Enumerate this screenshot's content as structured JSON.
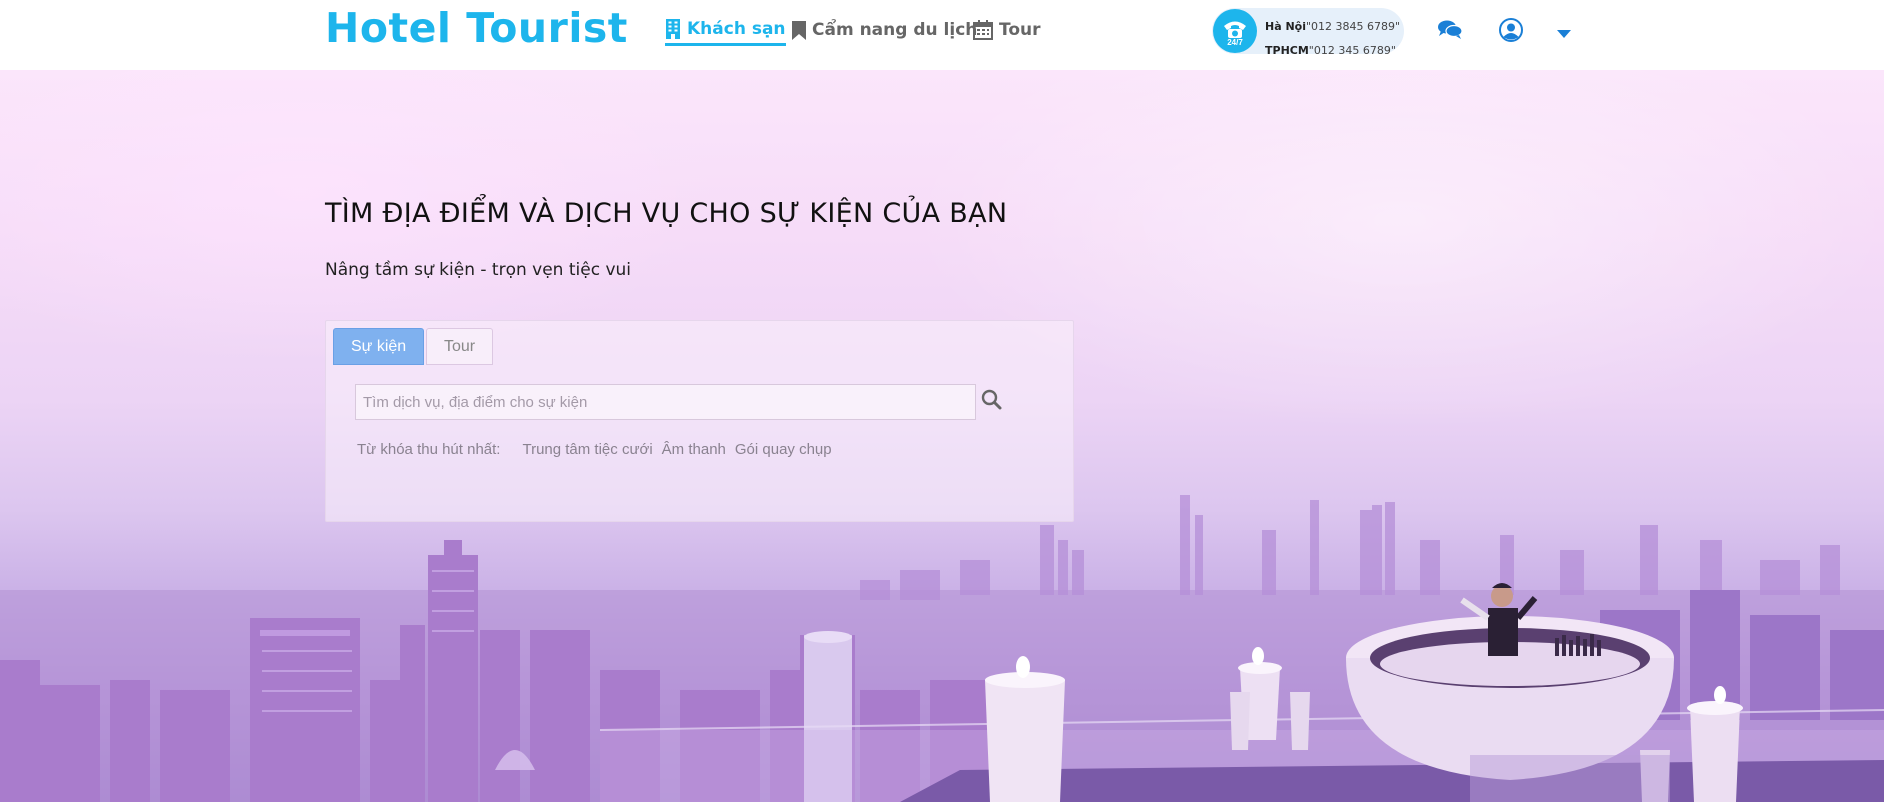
{
  "header": {
    "logo": "Hotel Tourist",
    "nav": [
      {
        "label": "Khách sạn",
        "icon": "building-icon",
        "active": true
      },
      {
        "label": "Cẩm nang du lịch",
        "icon": "bookmark-icon",
        "active": false
      },
      {
        "label": "Tour",
        "icon": "calendar-icon",
        "active": false
      }
    ],
    "hotline": {
      "badge": "24/7",
      "lines": [
        {
          "city": "Hà Nội",
          "phone": "\"012 3845 6789\""
        },
        {
          "city": "TPHCM",
          "phone": "\"012 345 6789\""
        }
      ]
    },
    "icons": [
      "chat-icon",
      "user-icon",
      "caret-down-icon"
    ]
  },
  "hero": {
    "title": "TÌM ĐỊA ĐIỂM VÀ DỊCH VỤ CHO SỰ KIỆN CỦA BẠN",
    "subtitle": "Nâng tầm sự kiện - trọn vẹn tiệc vui",
    "search": {
      "tabs": [
        "Sự kiện",
        "Tour"
      ],
      "active_tab": "Sự kiện",
      "placeholder": "Tìm dịch vụ, địa điểm cho sự kiện",
      "value": "",
      "keywords_label": "Từ khóa thu hút nhất:",
      "keywords": [
        "Trung tâm tiệc cưới",
        "Âm thanh",
        "Gói quay chụp"
      ]
    }
  },
  "colors": {
    "brand": "#1db5ec",
    "active_tab": "#7fb1ef"
  }
}
